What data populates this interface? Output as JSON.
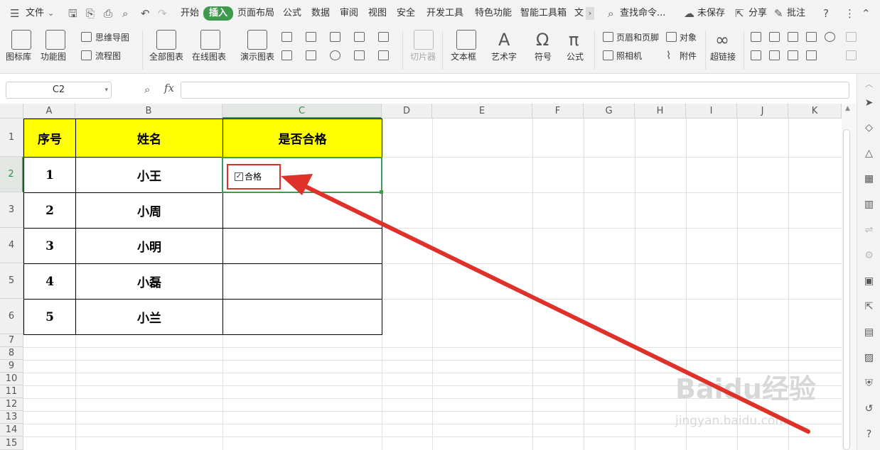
{
  "menubar": {
    "file": "文件",
    "tabs": [
      "开始",
      "插入",
      "页面布局",
      "公式",
      "数据",
      "审阅",
      "视图",
      "安全",
      "开发工具",
      "特色功能",
      "智能工具箱",
      "文"
    ],
    "search": "查找命令...",
    "unsaved": "未保存",
    "share": "分享",
    "comment": "批注"
  },
  "ribbon": {
    "icon_lib": "图标库",
    "func_chart": "功能图",
    "mindmap": "思维导图",
    "flowchart": "流程图",
    "all_charts": "全部图表",
    "online_charts": "在线图表",
    "demo_charts": "演示图表",
    "slicer": "切片器",
    "textbox": "文本框",
    "wordart": "艺术字",
    "symbol": "符号",
    "formula": "公式",
    "header_footer": "页眉和页脚",
    "object": "对象",
    "camera": "照相机",
    "attachment": "附件",
    "hyperlink": "超链接"
  },
  "formula_bar": {
    "cell_ref": "C2",
    "fx": "fx",
    "content": ""
  },
  "columns": [
    "A",
    "B",
    "C",
    "D",
    "E",
    "F",
    "G",
    "H",
    "I",
    "J",
    "K"
  ],
  "rows": [
    "1",
    "2",
    "3",
    "4",
    "5",
    "6",
    "7",
    "8",
    "9",
    "10",
    "11",
    "12",
    "13",
    "14",
    "15"
  ],
  "table": {
    "headers": [
      "序号",
      "姓名",
      "是否合格"
    ],
    "rows": [
      [
        "1",
        "小王"
      ],
      [
        "2",
        "小周"
      ],
      [
        "3",
        "小明"
      ],
      [
        "4",
        "小磊"
      ],
      [
        "5",
        "小兰"
      ]
    ]
  },
  "checkbox": {
    "label": "合格",
    "checked": true
  },
  "watermark": {
    "line1": "Baidu经验",
    "line2": "jingyan.baidu.com"
  },
  "colors": {
    "accent": "#3d9a4e",
    "header_fill": "#ffff00",
    "annotation": "#e0302a"
  }
}
